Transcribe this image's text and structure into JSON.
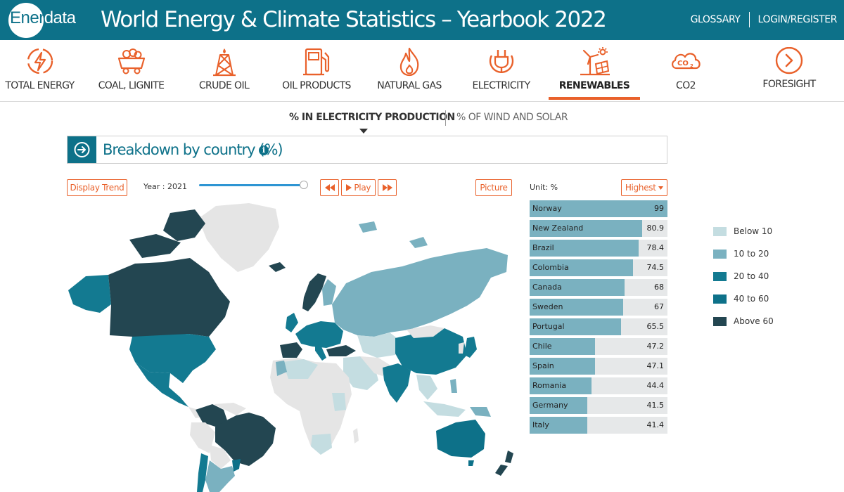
{
  "header": {
    "logo_text_a": "Ener",
    "logo_text_b": "data",
    "title": "World Energy & Climate Statistics – Yearbook 2022",
    "links": [
      "GLOSSARY",
      "LOGIN/REGISTER"
    ]
  },
  "nav": {
    "items": [
      {
        "label": "TOTAL ENERGY",
        "icon": "lightning-icon"
      },
      {
        "label": "COAL, LIGNITE",
        "icon": "mine-cart-icon"
      },
      {
        "label": "CRUDE OIL",
        "icon": "oil-derrick-icon"
      },
      {
        "label": "OIL PRODUCTS",
        "icon": "fuel-pump-icon"
      },
      {
        "label": "NATURAL GAS",
        "icon": "flame-icon"
      },
      {
        "label": "ELECTRICITY",
        "icon": "plug-icon"
      },
      {
        "label": "RENEWABLES",
        "icon": "wind-solar-icon"
      },
      {
        "label": "CO2",
        "icon": "co2-cloud-icon"
      },
      {
        "label": "FORESIGHT",
        "icon": "chevron-right-circle-icon"
      }
    ],
    "active": "RENEWABLES"
  },
  "subtabs": {
    "active": "% IN ELECTRICITY PRODUCTION",
    "inactive": "% OF WIND AND SOLAR"
  },
  "section": {
    "title": "Breakdown by country (%)",
    "info": "i"
  },
  "controls": {
    "display_trend": "Display Trend",
    "year_label": "Year : 2021",
    "year_position_pct": 100,
    "play_label": "Play",
    "picture_label": "Picture",
    "unit_label": "Unit: %",
    "sort_label": "Highest"
  },
  "ranking": [
    {
      "country": "Norway",
      "value": 99,
      "display": "99"
    },
    {
      "country": "New Zealand",
      "value": 80.9,
      "display": "80.9"
    },
    {
      "country": "Brazil",
      "value": 78.4,
      "display": "78.4"
    },
    {
      "country": "Colombia",
      "value": 74.5,
      "display": "74.5"
    },
    {
      "country": "Canada",
      "value": 68,
      "display": "68"
    },
    {
      "country": "Sweden",
      "value": 67,
      "display": "67"
    },
    {
      "country": "Portugal",
      "value": 65.5,
      "display": "65.5"
    },
    {
      "country": "Chile",
      "value": 47.2,
      "display": "47.2"
    },
    {
      "country": "Spain",
      "value": 47.1,
      "display": "47.1"
    },
    {
      "country": "Romania",
      "value": 44.4,
      "display": "44.4"
    },
    {
      "country": "Germany",
      "value": 41.5,
      "display": "41.5"
    },
    {
      "country": "Italy",
      "value": 41.4,
      "display": "41.4"
    }
  ],
  "legend": [
    {
      "label": "Below 10",
      "color": "#c4dde1"
    },
    {
      "label": "10 to 20",
      "color": "#7ab1c0"
    },
    {
      "label": "20 to 40",
      "color": "#137a91"
    },
    {
      "label": "40 to 60",
      "color": "#0d7189"
    },
    {
      "label": "Above 60",
      "color": "#234651"
    }
  ],
  "colors": {
    "brand": "#0d7189",
    "accent": "#e9612b",
    "no_data": "#e5e5e5"
  }
}
